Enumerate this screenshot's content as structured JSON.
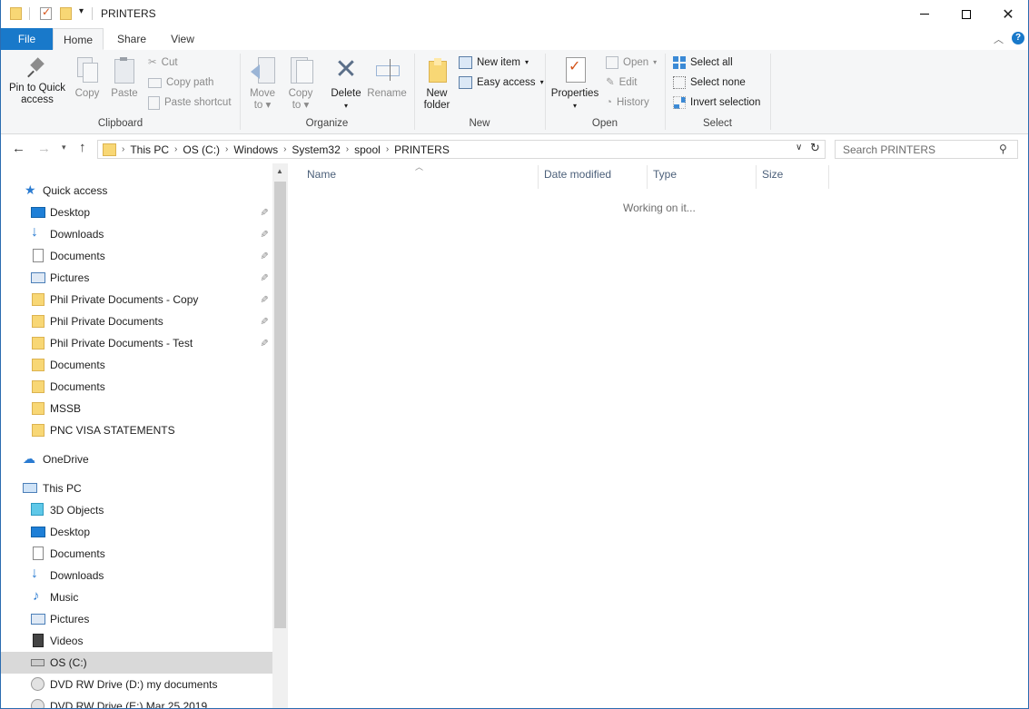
{
  "window": {
    "title": "PRINTERS"
  },
  "tabs": [
    {
      "label": "File"
    },
    {
      "label": "Home"
    },
    {
      "label": "Share"
    },
    {
      "label": "View"
    }
  ],
  "ribbon": {
    "clipboard": {
      "label": "Clipboard",
      "pin": "Pin to Quick access",
      "pin_l1": "Pin to Quick",
      "pin_l2": "access",
      "copy": "Copy",
      "paste": "Paste",
      "cut": "Cut",
      "copy_path": "Copy path",
      "paste_shortcut": "Paste shortcut"
    },
    "organize": {
      "label": "Organize",
      "move_l1": "Move",
      "move_l2": "to",
      "copy_l1": "Copy",
      "copy_l2": "to",
      "delete": "Delete",
      "rename": "Rename"
    },
    "new": {
      "label": "New",
      "folder_l1": "New",
      "folder_l2": "folder",
      "new_item": "New item",
      "easy_access": "Easy access"
    },
    "open": {
      "label": "Open",
      "properties": "Properties",
      "open": "Open",
      "edit": "Edit",
      "history": "History"
    },
    "select": {
      "label": "Select",
      "select_all": "Select all",
      "select_none": "Select none",
      "invert": "Invert selection"
    }
  },
  "address": {
    "crumbs": [
      "This PC",
      "OS (C:)",
      "Windows",
      "System32",
      "spool",
      "PRINTERS"
    ],
    "search_placeholder": "Search PRINTERS"
  },
  "nav": {
    "quick_access": "Quick access",
    "quick_items": [
      {
        "label": "Desktop",
        "icon": "desktop-icon",
        "pinned": true
      },
      {
        "label": "Downloads",
        "icon": "downloads-icon",
        "pinned": true
      },
      {
        "label": "Documents",
        "icon": "documents-icon",
        "pinned": true
      },
      {
        "label": "Pictures",
        "icon": "pictures-icon",
        "pinned": true
      },
      {
        "label": "Phil Private Documents - Copy",
        "icon": "folder-icon",
        "pinned": true
      },
      {
        "label": "Phil Private Documents",
        "icon": "folder-icon",
        "pinned": true
      },
      {
        "label": "Phil Private Documents - Test",
        "icon": "folder-icon",
        "pinned": true
      },
      {
        "label": "Documents",
        "icon": "folder-icon",
        "pinned": false
      },
      {
        "label": "Documents",
        "icon": "folder-icon",
        "pinned": false
      },
      {
        "label": "MSSB",
        "icon": "folder-icon",
        "pinned": false
      },
      {
        "label": "PNC VISA STATEMENTS",
        "icon": "folder-icon",
        "pinned": false
      }
    ],
    "onedrive": "OneDrive",
    "this_pc": "This PC",
    "pc_items": [
      {
        "label": "3D Objects",
        "icon": "3d-objects-icon"
      },
      {
        "label": "Desktop",
        "icon": "desktop-icon"
      },
      {
        "label": "Documents",
        "icon": "documents-icon"
      },
      {
        "label": "Downloads",
        "icon": "downloads-icon"
      },
      {
        "label": "Music",
        "icon": "music-icon"
      },
      {
        "label": "Pictures",
        "icon": "pictures-icon"
      },
      {
        "label": "Videos",
        "icon": "videos-icon"
      },
      {
        "label": "OS (C:)",
        "icon": "drive-icon"
      },
      {
        "label": "DVD RW Drive (D:) my documents",
        "icon": "dvd-icon"
      },
      {
        "label": "DVD RW Drive (E:) Mar 25 2019",
        "icon": "dvd-icon"
      }
    ]
  },
  "columns": [
    "Name",
    "Date modified",
    "Type",
    "Size"
  ],
  "status": {
    "working": "Working on it..."
  }
}
